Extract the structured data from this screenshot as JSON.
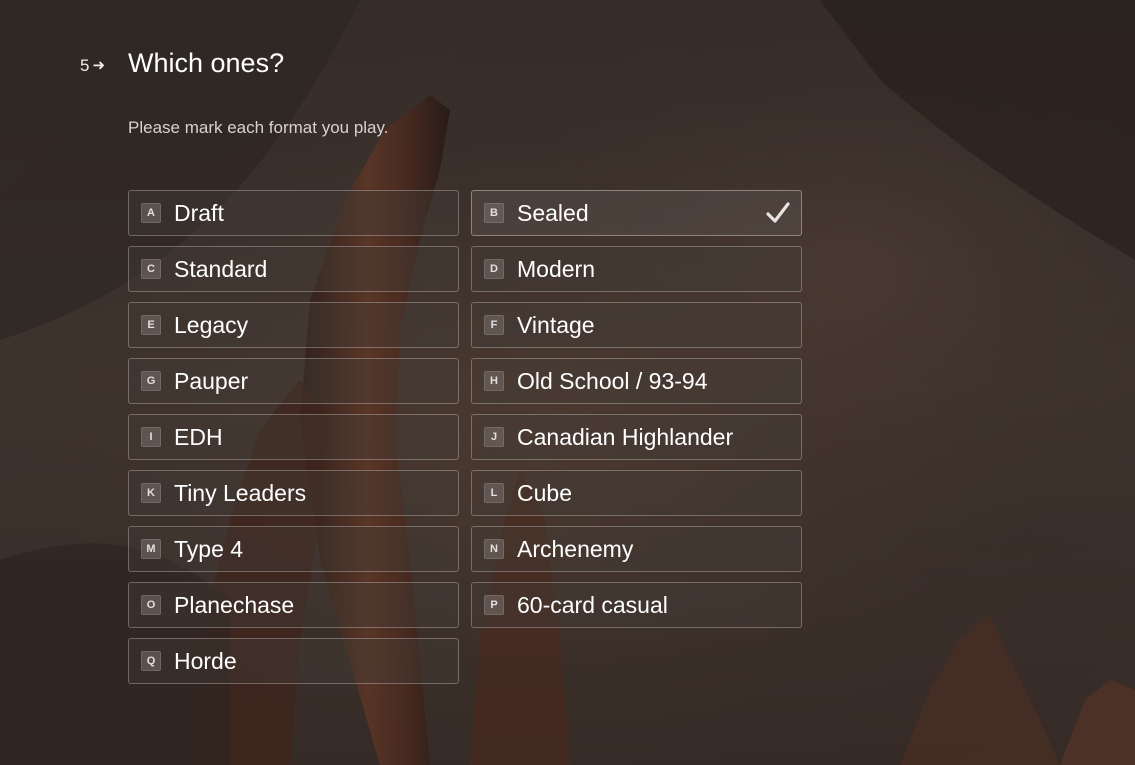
{
  "question": {
    "number": "5",
    "arrow_icon": "right-arrow-icon",
    "title": "Which ones?",
    "subtitle": "Please mark each format you play."
  },
  "choices": [
    {
      "key": "A",
      "label": "Draft",
      "selected": false
    },
    {
      "key": "B",
      "label": "Sealed",
      "selected": true
    },
    {
      "key": "C",
      "label": "Standard",
      "selected": false
    },
    {
      "key": "D",
      "label": "Modern",
      "selected": false
    },
    {
      "key": "E",
      "label": "Legacy",
      "selected": false
    },
    {
      "key": "F",
      "label": "Vintage",
      "selected": false
    },
    {
      "key": "G",
      "label": "Pauper",
      "selected": false
    },
    {
      "key": "H",
      "label": "Old School / 93-94",
      "selected": false
    },
    {
      "key": "I",
      "label": "EDH",
      "selected": false
    },
    {
      "key": "J",
      "label": "Canadian Highlander",
      "selected": false
    },
    {
      "key": "K",
      "label": "Tiny Leaders",
      "selected": false
    },
    {
      "key": "L",
      "label": "Cube",
      "selected": false
    },
    {
      "key": "M",
      "label": "Type 4",
      "selected": false
    },
    {
      "key": "N",
      "label": "Archenemy",
      "selected": false
    },
    {
      "key": "O",
      "label": "Planechase",
      "selected": false
    },
    {
      "key": "P",
      "label": "60-card casual",
      "selected": false
    },
    {
      "key": "Q",
      "label": "Horde",
      "selected": false
    }
  ],
  "colors": {
    "background": "#3c3431",
    "text": "#ffffff",
    "check": "#e8e4e0"
  }
}
